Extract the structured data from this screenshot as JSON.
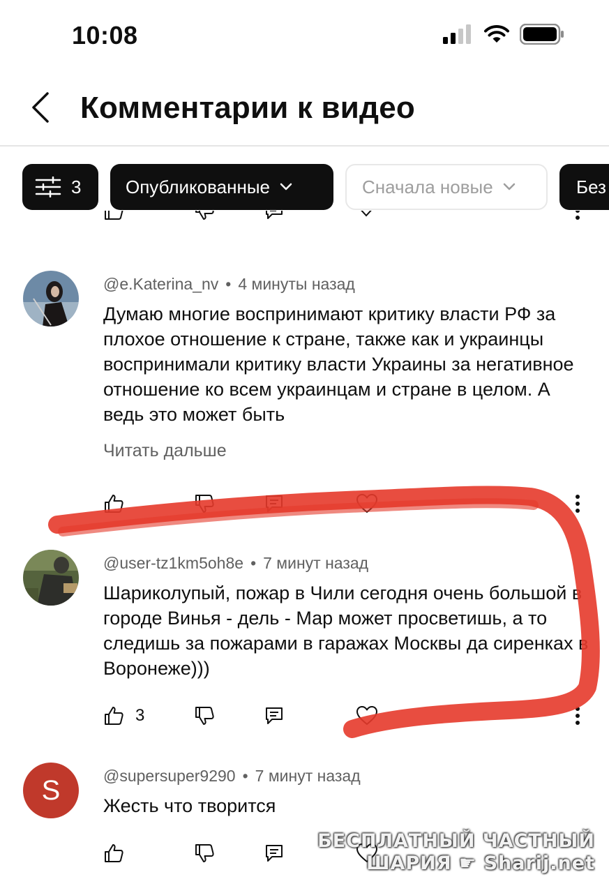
{
  "status_bar": {
    "time": "10:08"
  },
  "header": {
    "title": "Комментарии к видео"
  },
  "filters": {
    "filter_count": "3",
    "published": "Опубликованные",
    "sort": "Сначала новые",
    "partial": "Без"
  },
  "comments": [
    {
      "author": "@e.Katerina_nv",
      "time": "4 минуты назад",
      "text": "Думаю многие воспринимают критику власти РФ за плохое отношение к стране, также как и украинцы воспринимали критику власти Украины за негативное отношение ко всем украинцам и стране в целом. А ведь это может быть",
      "read_more": "Читать дальше",
      "likes": ""
    },
    {
      "author": "@user-tz1km5oh8e",
      "time": "7 минут назад",
      "text": "Шариколупый, пожар в Чили сегодня очень большой в городе Винья - дель - Мар может просветишь, а то следишь за пожарами в гаражах Москвы да сиренках в Воронеже)))",
      "likes": "3"
    },
    {
      "author": "@supersuper9290",
      "time": "7 минут назад",
      "text": "Жесть что творится",
      "avatar_letter": "S",
      "likes": ""
    }
  ],
  "watermark": {
    "line1": "БЕСПЛАТНЫЙ ЧАСТНЫЙ",
    "line2": "ШАРИЯ",
    "line2_site": "Sharij.net"
  },
  "colors": {
    "highlight": "#e53a2b",
    "avatar_s": "#c0392b",
    "chip_dark": "#0f0f0f"
  }
}
